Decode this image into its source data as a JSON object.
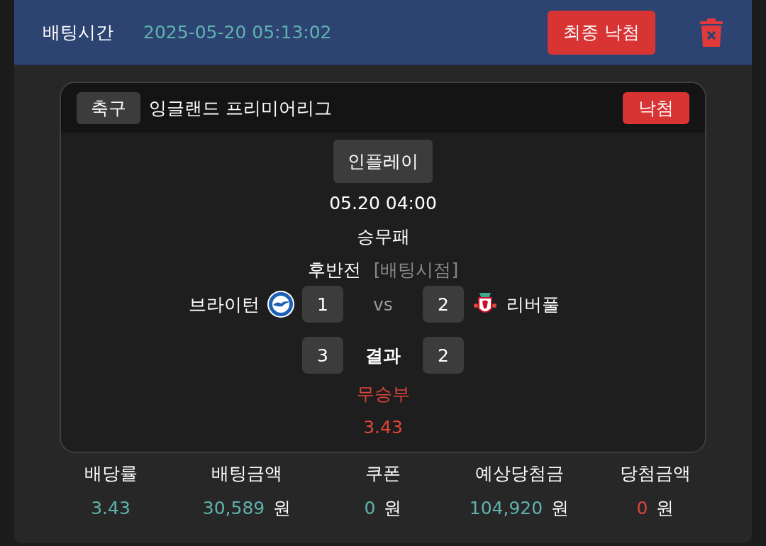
{
  "header": {
    "label": "배팅시간",
    "time": "2025-05-20 05:13:02",
    "final_button": "최종 낙첨"
  },
  "match": {
    "sport": "축구",
    "league": "잉글랜드 프리미어리그",
    "status": "낙첨",
    "mode": "인플레이",
    "datetime": "05.20 04:00",
    "market": "승무패",
    "period": "후반전",
    "period_note": "[배팅시점]",
    "vs": "vs",
    "result_label": "결과",
    "pick": "무승부",
    "odds": "3.43",
    "home": {
      "name": "브라이턴",
      "score_at_bet": "1",
      "score_final": "3"
    },
    "away": {
      "name": "리버풀",
      "score_at_bet": "2",
      "score_final": "2"
    }
  },
  "stats": [
    {
      "label": "배당률",
      "value": "3.43",
      "color": "#5fb3ad"
    },
    {
      "label": "배팅금액",
      "value": "30,589",
      "unit": "원",
      "color": "#5fb3ad"
    },
    {
      "label": "쿠폰",
      "value": "0",
      "unit": "원",
      "color": "#5fb3ad"
    },
    {
      "label": "예상당첨금",
      "value": "104,920",
      "unit": "원",
      "color": "#5fb3ad"
    },
    {
      "label": "당첨금액",
      "value": "0",
      "unit": "원",
      "color": "#e0453a"
    }
  ]
}
